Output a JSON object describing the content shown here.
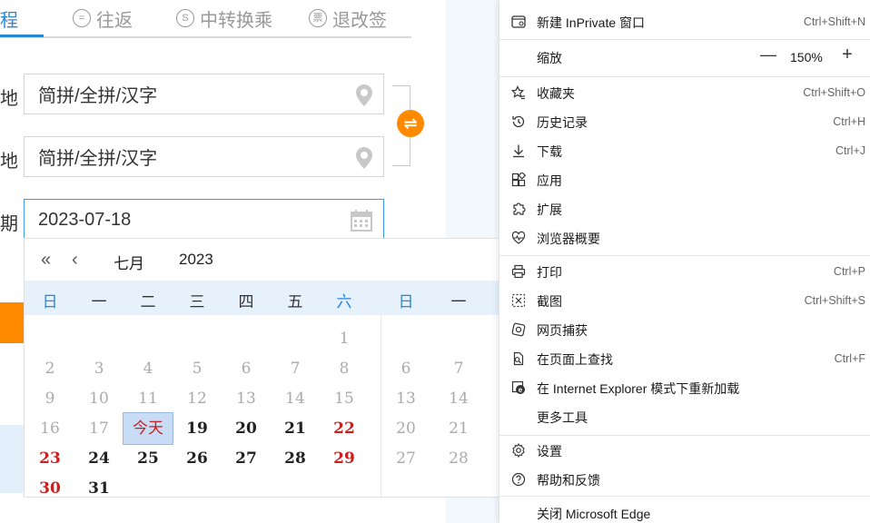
{
  "tabs": {
    "active_label": "程",
    "round_trip": {
      "icon_text": "=",
      "label": "往返"
    },
    "transfer": {
      "icon_text": "S",
      "label": "中转换乘"
    },
    "refund": {
      "icon_text": "票",
      "label": "退改签"
    }
  },
  "form": {
    "from_label": "地",
    "to_label": "地",
    "date_label": "期",
    "from_placeholder": "简拼/全拼/汉字",
    "to_placeholder": "简拼/全拼/汉字",
    "date_value": "2023-07-18"
  },
  "calendar": {
    "prev_year": "«",
    "prev_month": "‹",
    "month": "七月",
    "year": "2023",
    "weekdays": [
      "日",
      "一",
      "二",
      "三",
      "四",
      "五",
      "六"
    ],
    "weekdays_next": [
      "日",
      "一"
    ],
    "today_label": "今天",
    "rows": [
      [
        "",
        "",
        "",
        "",
        "",
        "",
        "1"
      ],
      [
        "2",
        "3",
        "4",
        "5",
        "6",
        "7",
        "8"
      ],
      [
        "9",
        "10",
        "11",
        "12",
        "13",
        "14",
        "15"
      ],
      [
        "16",
        "17",
        "今天",
        "19",
        "20",
        "21",
        "22"
      ],
      [
        "23",
        "24",
        "25",
        "26",
        "27",
        "28",
        "29"
      ],
      [
        "30",
        "31",
        "",
        "",
        "",
        "",
        ""
      ]
    ],
    "next_rows": [
      [
        "",
        ""
      ],
      [
        "6",
        "7"
      ],
      [
        "13",
        "14"
      ],
      [
        "20",
        "21"
      ],
      [
        "27",
        "28"
      ],
      [
        "",
        ""
      ]
    ]
  },
  "menu": {
    "inprivate": {
      "label": "新建 InPrivate 窗口",
      "shortcut": "Ctrl+Shift+N"
    },
    "zoom": {
      "label": "缩放",
      "minus": "—",
      "value": "150%",
      "plus": "+"
    },
    "favorites": {
      "label": "收藏夹",
      "shortcut": "Ctrl+Shift+O"
    },
    "history": {
      "label": "历史记录",
      "shortcut": "Ctrl+H"
    },
    "downloads": {
      "label": "下载",
      "shortcut": "Ctrl+J"
    },
    "apps": {
      "label": "应用"
    },
    "extensions": {
      "label": "扩展"
    },
    "essentials": {
      "label": "浏览器概要"
    },
    "print": {
      "label": "打印",
      "shortcut": "Ctrl+P"
    },
    "screenshot": {
      "label": "截图",
      "shortcut": "Ctrl+Shift+S"
    },
    "web_capture": {
      "label": "网页捕获"
    },
    "find": {
      "label": "在页面上查找",
      "shortcut": "Ctrl+F"
    },
    "ie_mode": {
      "label": "在 Internet Explorer 模式下重新加载"
    },
    "more_tools": {
      "label": "更多工具"
    },
    "settings": {
      "label": "设置"
    },
    "help": {
      "label": "帮助和反馈"
    },
    "close": {
      "label": "关闭 Microsoft Edge"
    }
  },
  "colors": {
    "accent_blue": "#2a86d8",
    "accent_orange": "#ff8a00",
    "holiday_red": "#c91f1f"
  }
}
